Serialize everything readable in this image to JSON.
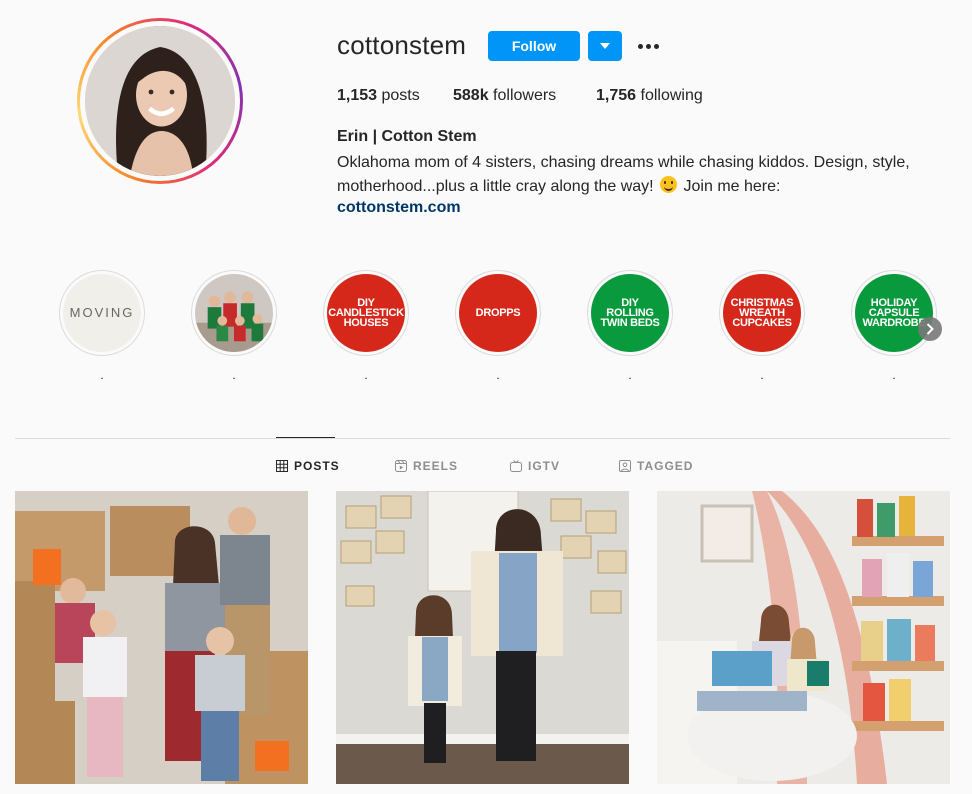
{
  "profile": {
    "username": "cottonstem",
    "follow_label": "Follow",
    "stats": {
      "posts_count": "1,153",
      "posts_label": "posts",
      "followers_count": "588k",
      "followers_label": "followers",
      "following_count": "1,756",
      "following_label": "following"
    },
    "full_name": "Erin | Cotton Stem",
    "bio_line1": "Oklahoma mom of 4 sisters, chasing dreams while chasing kiddos. Design, style,",
    "bio_line2a": "motherhood...plus a little cray along the way!",
    "bio_line2b": "Join me here:",
    "website": "cottonstem.com"
  },
  "highlights": [
    {
      "cover_text": "MOVING",
      "label": ".",
      "style": "moving"
    },
    {
      "cover_text": "",
      "label": ".",
      "style": "photo"
    },
    {
      "cover_text": "DIY\nCANDLESTICK\nHOUSES",
      "label": ".",
      "style": "red"
    },
    {
      "cover_text": "DROPPS",
      "label": ".",
      "style": "red"
    },
    {
      "cover_text": "DIY\nROLLING\nTWIN BEDS",
      "label": ".",
      "style": "green"
    },
    {
      "cover_text": "CHRISTMAS\nWREATH\nCUPCAKES",
      "label": ".",
      "style": "red"
    },
    {
      "cover_text": "HOLIDAY\nCAPSULE\nWARDROBE",
      "label": ".",
      "style": "green"
    }
  ],
  "tabs": {
    "posts": "POSTS",
    "reels": "REELS",
    "igtv": "IGTV",
    "tagged": "TAGGED"
  },
  "colors": {
    "accent": "#0095f6",
    "link": "#00376b",
    "highlight_red": "#d5281b",
    "highlight_green": "#0a9a3e"
  }
}
